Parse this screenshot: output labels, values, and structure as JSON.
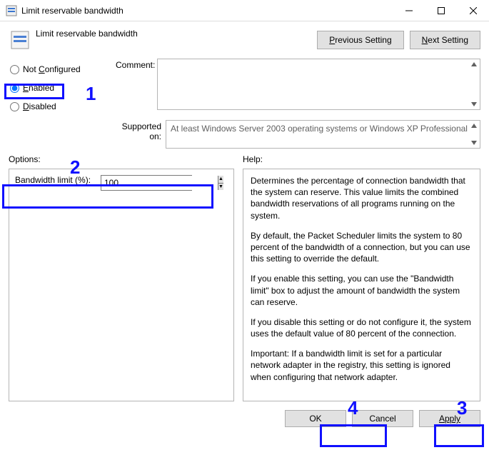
{
  "window": {
    "title": "Limit reservable bandwidth"
  },
  "header": {
    "title": "Limit reservable bandwidth",
    "prev": "Previous Setting",
    "next": "Next Setting"
  },
  "radios": {
    "not_configured": "Not Configured",
    "enabled": "Enabled",
    "disabled": "Disabled"
  },
  "labels": {
    "comment": "Comment:",
    "supported": "Supported on:",
    "options": "Options:",
    "help": "Help:",
    "bandwidth": "Bandwidth limit (%):"
  },
  "supported_text": "At least Windows Server 2003 operating systems or Windows XP Professional",
  "bandwidth_value": "100",
  "help": {
    "p1": "Determines the percentage of connection bandwidth that the system can reserve. This value limits the combined bandwidth reservations of all programs running on the system.",
    "p2": "By default, the Packet Scheduler limits the system to 80 percent of the bandwidth of a connection, but you can use this setting to override the default.",
    "p3": "If you enable this setting, you can use the \"Bandwidth limit\" box to adjust the amount of bandwidth the system can reserve.",
    "p4": "If you disable this setting or do not configure it, the system uses the default value of 80 percent of the connection.",
    "p5": "Important: If a bandwidth limit is set for a particular network adapter in the registry, this setting is ignored when configuring that network adapter."
  },
  "buttons": {
    "ok": "OK",
    "cancel": "Cancel",
    "apply": "Apply"
  },
  "annot": {
    "n1": "1",
    "n2": "2",
    "n3": "3",
    "n4": "4"
  }
}
